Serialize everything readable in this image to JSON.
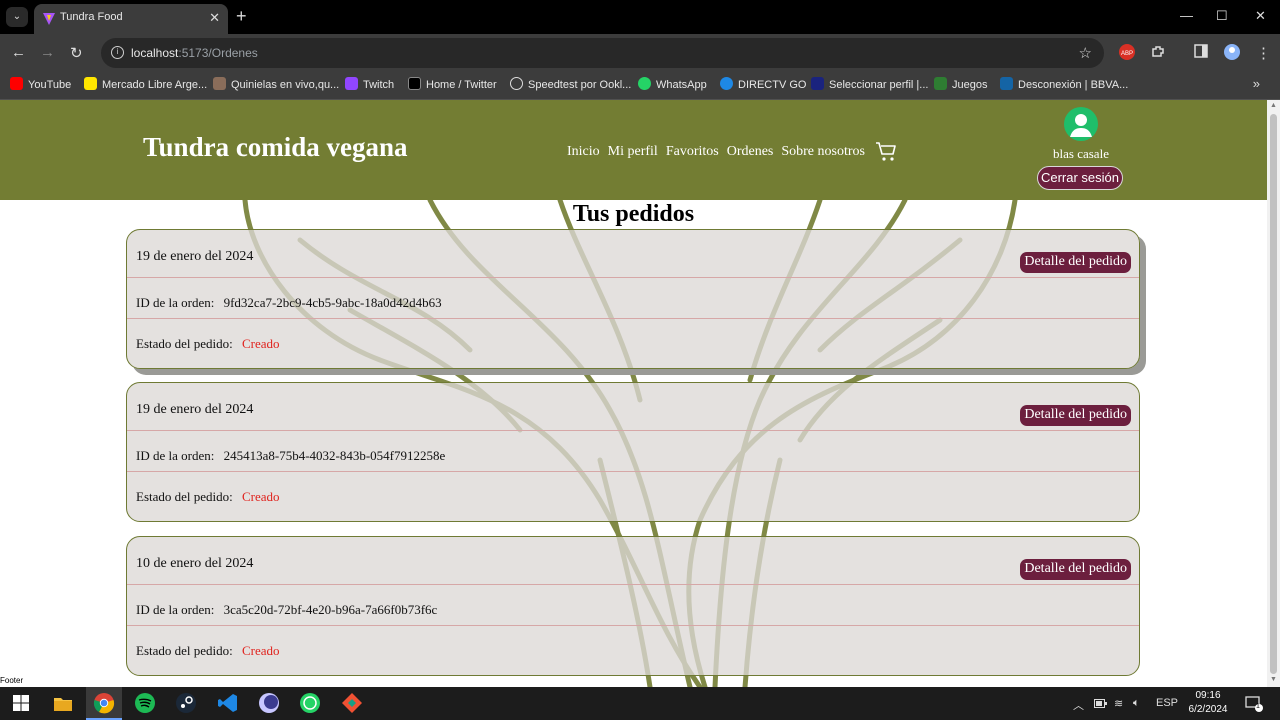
{
  "browser": {
    "tab_title": "Tundra Food",
    "url_host": "localhost",
    "url_path": ":5173/Ordenes",
    "bookmarks": [
      {
        "label": "YouTube",
        "color": "#ff0000"
      },
      {
        "label": "Mercado Libre Arge...",
        "color": "#ffe600"
      },
      {
        "label": "Quinielas en vivo,qu...",
        "color": "#8a6d5a"
      },
      {
        "label": "Twitch",
        "color": "#9146ff"
      },
      {
        "label": "Home / Twitter",
        "color": "#000000"
      },
      {
        "label": "Speedtest por Ookl...",
        "color": "#222222"
      },
      {
        "label": "WhatsApp",
        "color": "#25d366"
      },
      {
        "label": "DIRECTV GO",
        "color": "#1e88e5"
      },
      {
        "label": "Seleccionar perfil |...",
        "color": "#1a237e"
      },
      {
        "label": "Juegos",
        "color": "#2e7d32"
      },
      {
        "label": "Desconexión | BBVA...",
        "color": "#1464a5"
      }
    ]
  },
  "site": {
    "brand": "Tundra comida vegana",
    "nav": [
      "Inicio",
      "Mi perfil",
      "Favoritos",
      "Ordenes",
      "Sobre nosotros"
    ],
    "user_name": "blas casale",
    "logout_label": "Cerrar sesión",
    "page_title": "Tus pedidos",
    "footer": "Footer",
    "colors": {
      "header": "#737d33",
      "accent": "#6c1f3e",
      "status": "#e0241f"
    }
  },
  "orders": [
    {
      "date": "19 de enero del 2024",
      "detail_label": "Detalle del pedido",
      "id_label": "ID de la orden:",
      "id": "9fd32ca7-2bc9-4cb5-9abc-18a0d42d4b63",
      "status_label": "Estado del pedido:",
      "status": "Creado"
    },
    {
      "date": "19 de enero del 2024",
      "detail_label": "Detalle del pedido",
      "id_label": "ID de la orden:",
      "id": "245413a8-75b4-4032-843b-054f7912258e",
      "status_label": "Estado del pedido:",
      "status": "Creado"
    },
    {
      "date": "10 de enero del 2024",
      "detail_label": "Detalle del pedido",
      "id_label": "ID de la orden:",
      "id": "3ca5c20d-72bf-4e20-b96a-7a66f0b73f6c",
      "status_label": "Estado del pedido:",
      "status": "Creado"
    }
  ],
  "taskbar": {
    "lang": "ESP",
    "time": "09:16",
    "date": "6/2/2024",
    "notifications": "1"
  }
}
